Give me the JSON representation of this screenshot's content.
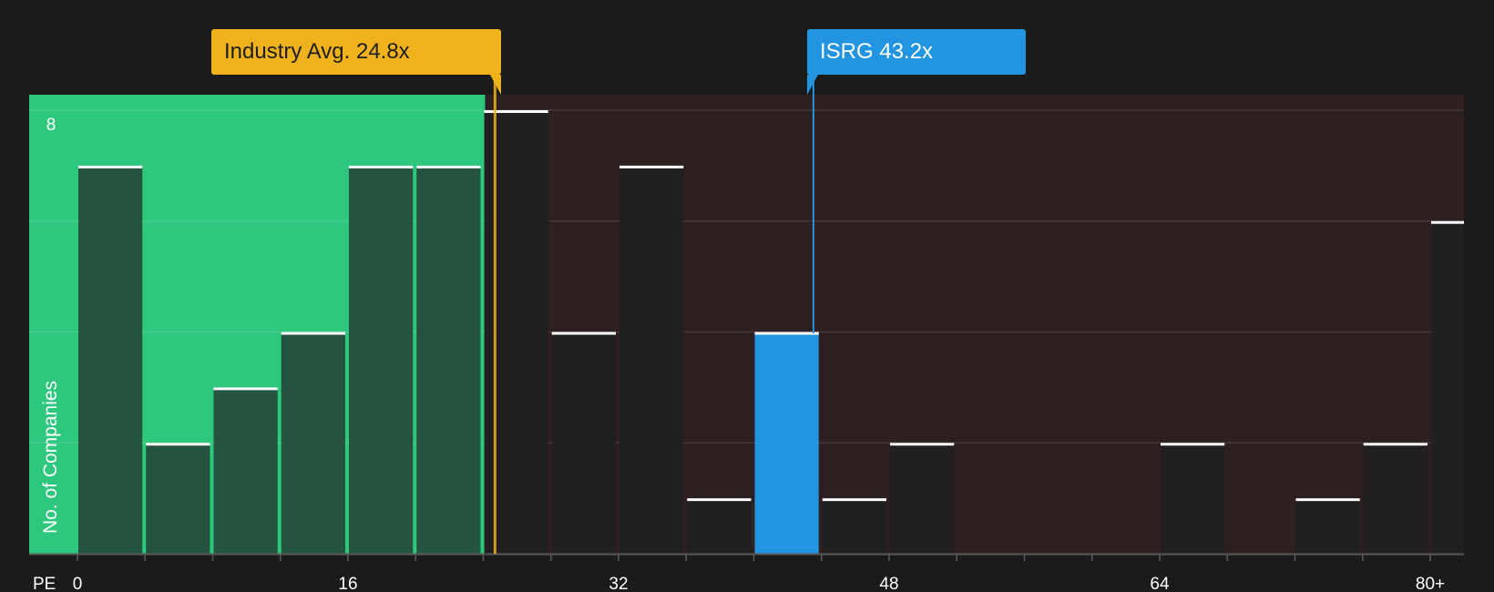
{
  "chart_data": {
    "type": "bar",
    "xlabel": "PE",
    "ylabel": "No. of Companies",
    "x_tick_labels": [
      "0",
      "16",
      "32",
      "48",
      "64",
      "80+"
    ],
    "y_tick_labels": [
      "8"
    ],
    "ylim": [
      0,
      8
    ],
    "bin_width": 4,
    "bins": [
      {
        "x0": 0,
        "x1": 4,
        "count": 7
      },
      {
        "x0": 4,
        "x1": 8,
        "count": 2
      },
      {
        "x0": 8,
        "x1": 12,
        "count": 3
      },
      {
        "x0": 12,
        "x1": 16,
        "count": 4
      },
      {
        "x0": 16,
        "x1": 20,
        "count": 7
      },
      {
        "x0": 20,
        "x1": 24,
        "count": 7
      },
      {
        "x0": 24,
        "x1": 28,
        "count": 8
      },
      {
        "x0": 28,
        "x1": 32,
        "count": 4
      },
      {
        "x0": 32,
        "x1": 36,
        "count": 7
      },
      {
        "x0": 36,
        "x1": 40,
        "count": 1
      },
      {
        "x0": 40,
        "x1": 44,
        "count": 4,
        "highlight": true
      },
      {
        "x0": 44,
        "x1": 48,
        "count": 1
      },
      {
        "x0": 48,
        "x1": 52,
        "count": 2
      },
      {
        "x0": 52,
        "x1": 56,
        "count": 0
      },
      {
        "x0": 56,
        "x1": 60,
        "count": 0
      },
      {
        "x0": 60,
        "x1": 64,
        "count": 0
      },
      {
        "x0": 64,
        "x1": 68,
        "count": 2
      },
      {
        "x0": 68,
        "x1": 72,
        "count": 0
      },
      {
        "x0": 72,
        "x1": 76,
        "count": 1
      },
      {
        "x0": 76,
        "x1": 80,
        "count": 2
      },
      {
        "x0": 80,
        "x1": 84,
        "count": 6
      }
    ],
    "industry_avg": {
      "value": 24.8,
      "label": "Industry Avg. 24.8x"
    },
    "company": {
      "ticker": "ISRG",
      "value": 43.2,
      "label": "ISRG 43.2x"
    },
    "grid": true,
    "colors": {
      "background": "#1b1b1b",
      "below_avg_zone": "#2ec77e",
      "above_avg_zone": "#2e1f20",
      "bar_in_green": "#244a39",
      "bar_dark": "#211f1f",
      "bar_highlight": "#2394e0",
      "industry_line": "#efb21c",
      "company_line": "#2394e0"
    }
  }
}
